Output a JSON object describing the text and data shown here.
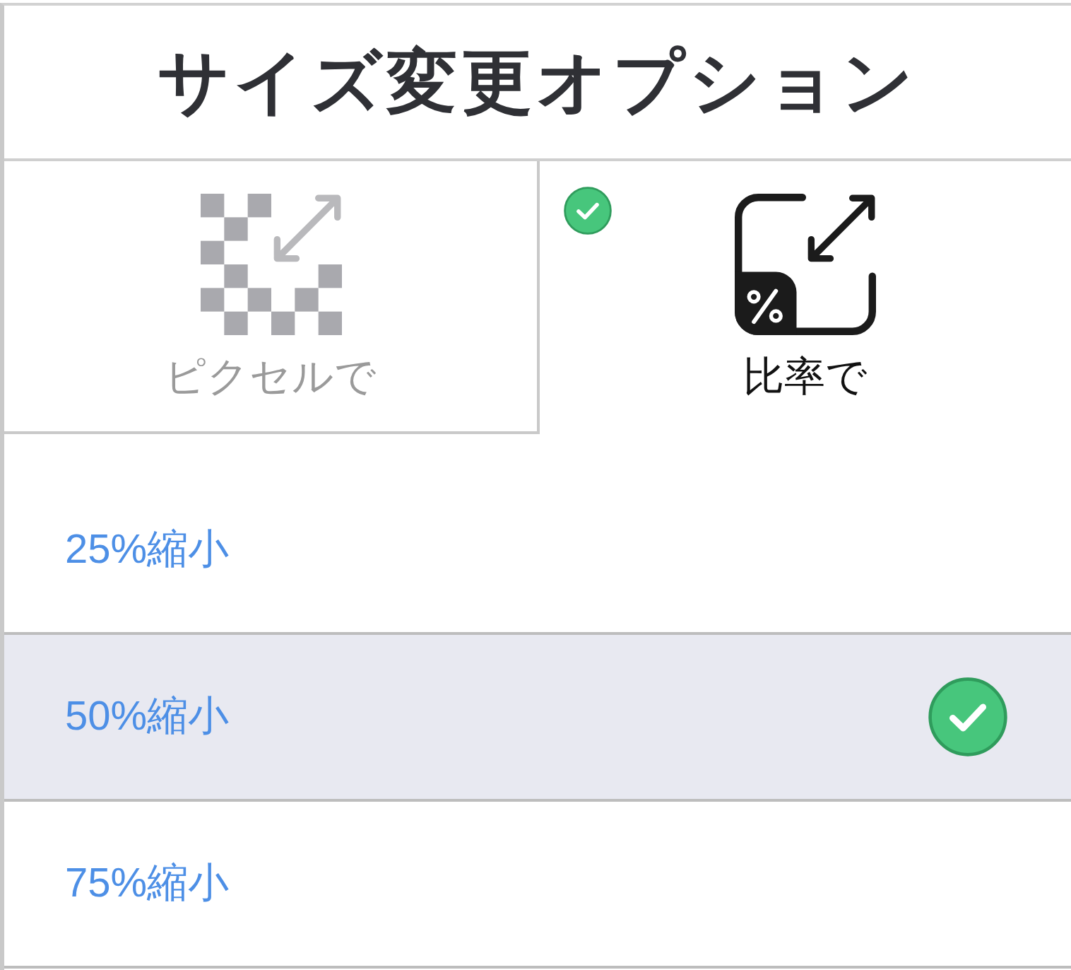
{
  "title": "サイズ変更オプション",
  "tabs": [
    {
      "label": "ピクセルで",
      "kind": "pixels",
      "selected": false
    },
    {
      "label": "比率で",
      "kind": "ratio",
      "selected": true
    }
  ],
  "options": [
    {
      "label": "25%縮小",
      "selected": false
    },
    {
      "label": "50%縮小",
      "selected": true
    },
    {
      "label": "75%縮小",
      "selected": false
    }
  ]
}
